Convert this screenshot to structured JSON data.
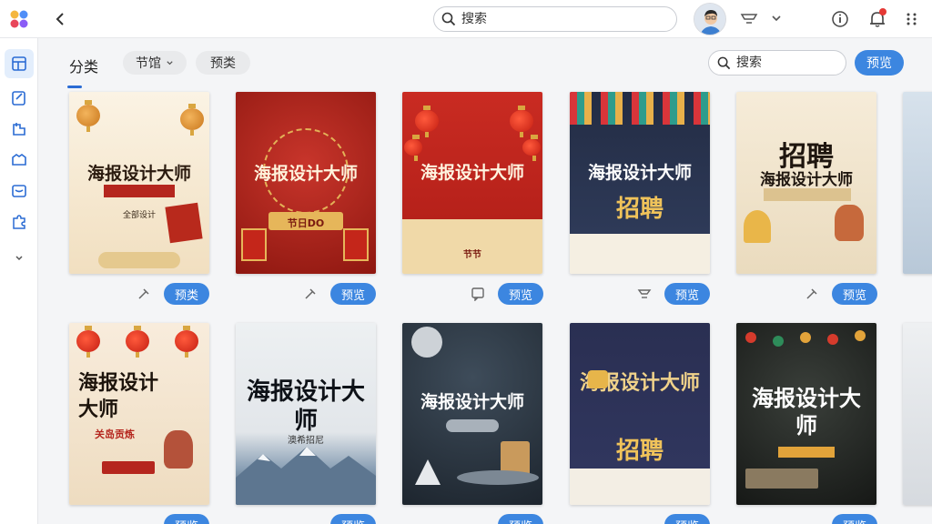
{
  "topbar": {
    "search_placeholder": "搜索"
  },
  "filters": {
    "category_label": "分类",
    "chips": [
      "节馆",
      "预类"
    ],
    "search_placeholder": "搜索",
    "preview_label": "预览"
  },
  "cards": [
    {
      "title": "海报设计大师",
      "subtitle": "全部设计",
      "label": "预类"
    },
    {
      "title": "海报设计大师",
      "subtitle": "节日DO",
      "label": "预览"
    },
    {
      "title": "海报设计大师",
      "subtitle": "节节",
      "label": "预览"
    },
    {
      "title": "海报设计大师",
      "subtitle": "招聘",
      "label": "预览"
    },
    {
      "title": "招聘",
      "subtitle": "海报设计大师",
      "label": "预览"
    },
    {
      "title": "海报设计大师",
      "subtitle": "关岛贡炼",
      "label": "预览"
    },
    {
      "title": "海报设计大师",
      "subtitle": "澳希招尼",
      "label": "预览"
    },
    {
      "title": "海报设计大师",
      "subtitle": "",
      "label": "预览"
    },
    {
      "title": "海报设计大师",
      "subtitle": "招聘",
      "label": "预览"
    },
    {
      "title": "海报设计大师",
      "subtitle": "",
      "label": "预览"
    }
  ],
  "colors": {
    "accent": "#3c86e0",
    "active_sidebar": "#e3eefc",
    "notification": "#e53935"
  }
}
